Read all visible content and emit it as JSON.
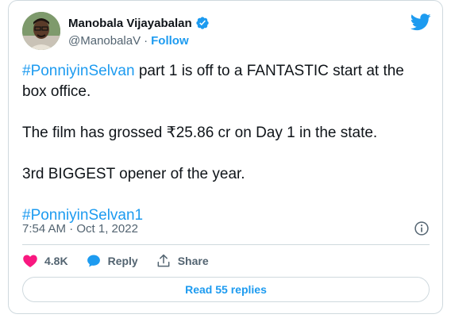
{
  "author": {
    "name": "Manobala Vijayabalan",
    "handle": "@ManobalaV",
    "separator": "·",
    "follow_label": "Follow"
  },
  "tweet": {
    "line1_hashtag": "#PonniyinSelvan",
    "line1_text": " part 1 is off to a FANTASTIC start at the box office.",
    "line2": "The film has grossed ₹25.86 cr on Day 1 in the state.",
    "line3": "3rd BIGGEST opener of the year.",
    "line4_hashtag": "#PonniyinSelvan1",
    "timestamp": "7:54 AM · Oct 1, 2022"
  },
  "actions": {
    "likes": "4.8K",
    "reply_label": "Reply",
    "share_label": "Share"
  },
  "read_replies_label": "Read 55 replies",
  "colors": {
    "accent": "#1d9bf0",
    "heart": "#f91880",
    "text": "#0f1419",
    "muted": "#536471",
    "border": "#cfd9de"
  },
  "icons": [
    "avatar",
    "verified-badge-icon",
    "twitter-bird-icon",
    "info-icon",
    "heart-icon",
    "reply-bubble-icon",
    "share-icon"
  ]
}
